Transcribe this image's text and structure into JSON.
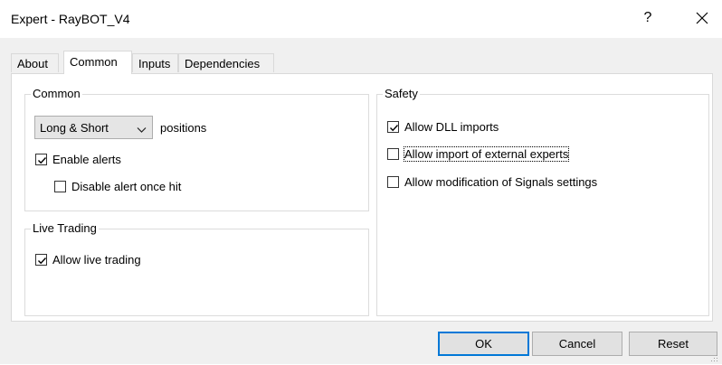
{
  "window": {
    "title": "Expert - RayBOT_V4",
    "help_label": "?"
  },
  "tabs": [
    {
      "label": "About"
    },
    {
      "label": "Common"
    },
    {
      "label": "Inputs"
    },
    {
      "label": "Dependencies"
    }
  ],
  "common": {
    "group_label": "Common",
    "positions_select": "Long & Short",
    "positions_label": "positions",
    "enable_alerts": {
      "label": "Enable alerts",
      "checked": true
    },
    "disable_alert_once_hit": {
      "label": "Disable alert once hit",
      "checked": false
    }
  },
  "live_trading": {
    "group_label": "Live Trading",
    "allow_live_trading": {
      "label": "Allow live trading",
      "checked": true
    }
  },
  "safety": {
    "group_label": "Safety",
    "allow_dll_imports": {
      "label": "Allow DLL imports",
      "checked": true
    },
    "allow_import_external_experts": {
      "label": "Allow import of external experts",
      "checked": false
    },
    "allow_modification_signals": {
      "label": "Allow modification of Signals settings",
      "checked": false
    }
  },
  "buttons": {
    "ok": "OK",
    "cancel": "Cancel",
    "reset": "Reset"
  },
  "icons": {
    "close": "close-icon",
    "help": "help-icon",
    "dropdown": "chevron-down-icon",
    "check": "checkmark-icon",
    "grip": "resize-grip-icon"
  }
}
